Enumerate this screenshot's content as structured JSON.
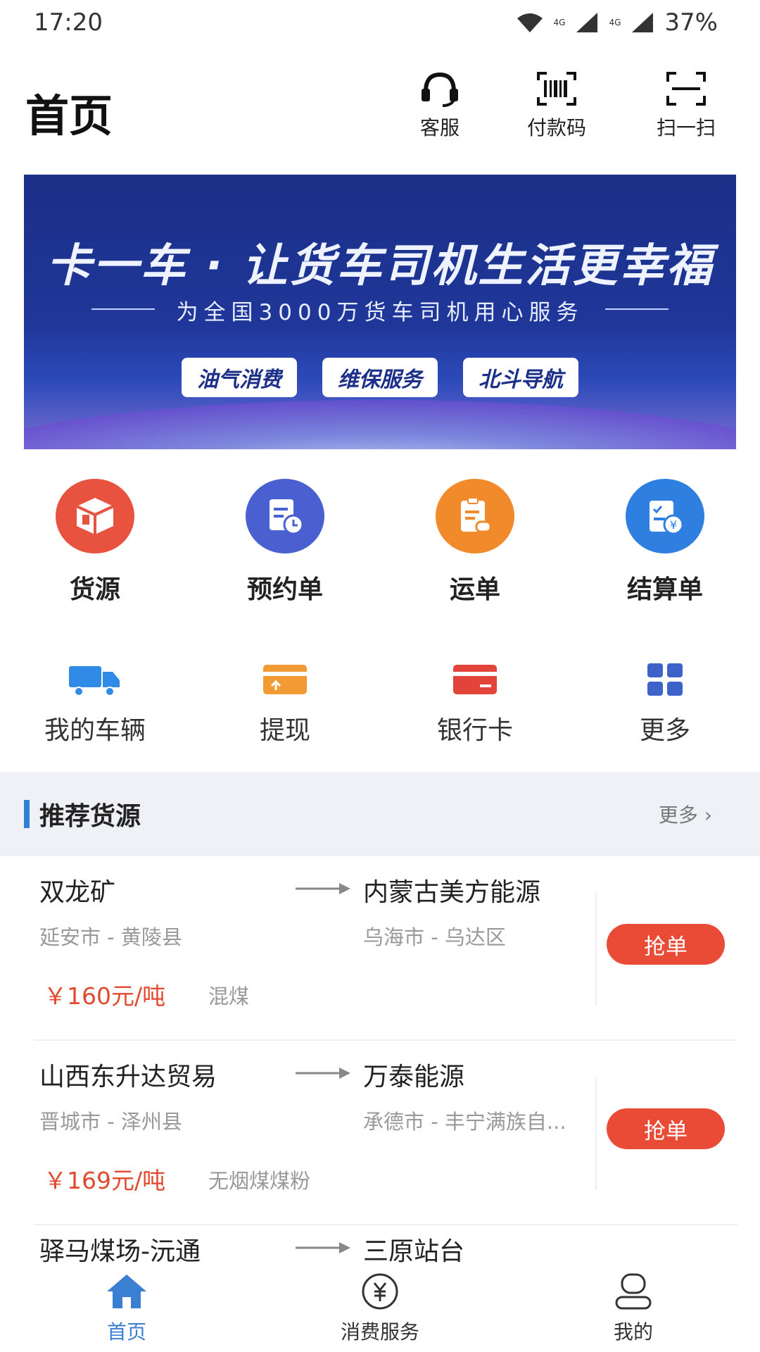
{
  "status_bar": {
    "time": "17:20",
    "net1": "4G",
    "net2": "4G",
    "battery": "37%"
  },
  "header": {
    "title": "首页",
    "actions": [
      {
        "label": "客服",
        "icon": "headset-icon"
      },
      {
        "label": "付款码",
        "icon": "barcode-icon"
      },
      {
        "label": "扫一扫",
        "icon": "scan-icon"
      }
    ]
  },
  "banner": {
    "title": "卡一车 · 让货车司机生活更幸福",
    "subtitle": "为全国3000万货车司机用心服务",
    "pills": [
      "油气消费",
      "维保服务",
      "北斗导航"
    ]
  },
  "main_grid": [
    {
      "label": "货源",
      "icon": "cargo-box-icon",
      "color": "#e7533f"
    },
    {
      "label": "预约单",
      "icon": "schedule-doc-icon",
      "color": "#4a5fd0"
    },
    {
      "label": "运单",
      "icon": "waybill-icon",
      "color": "#f08a2a"
    },
    {
      "label": "结算单",
      "icon": "settlement-icon",
      "color": "#2f7fe0"
    }
  ],
  "sub_grid": [
    {
      "label": "我的车辆",
      "icon": "truck-icon"
    },
    {
      "label": "提现",
      "icon": "withdraw-card-icon"
    },
    {
      "label": "银行卡",
      "icon": "bank-card-icon"
    },
    {
      "label": "更多",
      "icon": "grid-more-icon"
    }
  ],
  "section": {
    "title": "推荐货源",
    "more": "更多 ›"
  },
  "cargo": [
    {
      "from": "双龙矿",
      "from_region": "延安市 - 黄陵县",
      "to": "内蒙古美方能源",
      "to_region": "乌海市 - 乌达区",
      "price": "￥160元/吨",
      "type": "混煤",
      "action": "抢单"
    },
    {
      "from": "山西东升达贸易",
      "from_region": "晋城市 - 泽州县",
      "to": "万泰能源",
      "to_region": "承德市 - 丰宁满族自...",
      "price": "￥169元/吨",
      "type": "无烟煤煤粉",
      "action": "抢单"
    },
    {
      "from": "驿马煤场-沅通",
      "to": "三原站台"
    }
  ],
  "tabbar": [
    {
      "label": "首页",
      "icon": "home-icon",
      "active": true
    },
    {
      "label": "消费服务",
      "icon": "yuan-circle-icon",
      "active": false
    },
    {
      "label": "我的",
      "icon": "profile-icon",
      "active": false
    }
  ],
  "colors": {
    "accent": "#3b7fd3",
    "price": "#e24a2f",
    "grab_button": "#ea4b37"
  }
}
